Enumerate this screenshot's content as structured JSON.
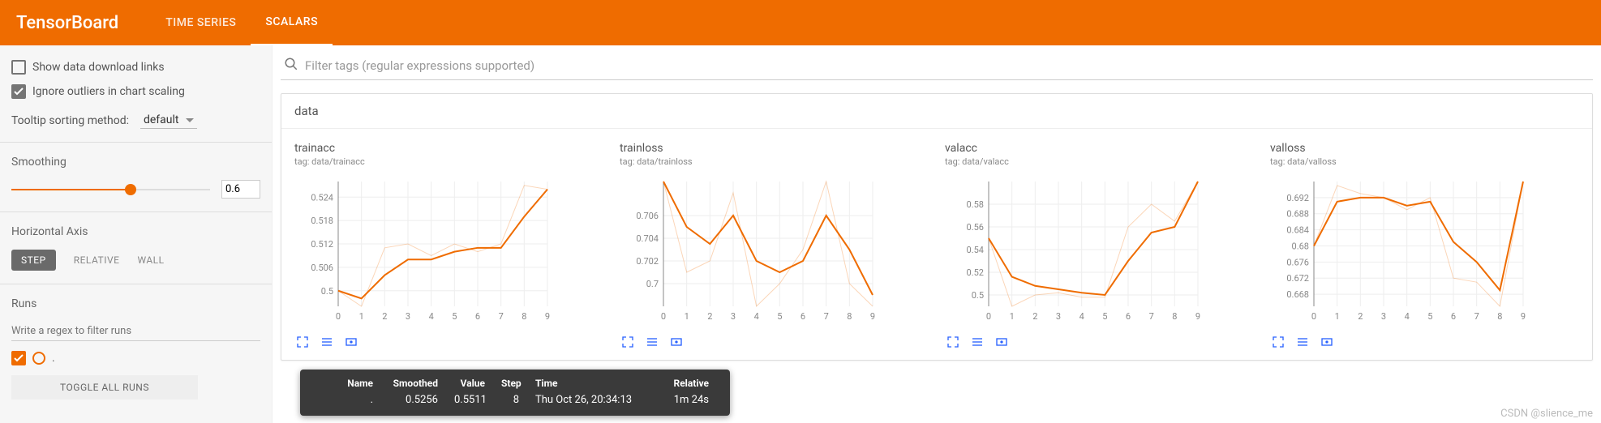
{
  "header": {
    "brand": "TensorBoard",
    "tabs": [
      {
        "label": "TIME SERIES",
        "active": false
      },
      {
        "label": "SCALARS",
        "active": true
      }
    ]
  },
  "sidebar": {
    "show_download": {
      "label": "Show data download links",
      "checked": false
    },
    "ignore_outliers": {
      "label": "Ignore outliers in chart scaling",
      "checked": true
    },
    "tooltip_sort": {
      "label": "Tooltip sorting method:",
      "value": "default"
    },
    "smoothing": {
      "label": "Smoothing",
      "value": "0.6",
      "pct": 60
    },
    "haxis": {
      "label": "Horizontal Axis",
      "options": [
        "STEP",
        "RELATIVE",
        "WALL"
      ],
      "active": 0
    },
    "runs": {
      "label": "Runs",
      "filter_placeholder": "Write a regex to filter runs",
      "items": [
        {
          "label": ".",
          "checked": true
        }
      ],
      "toggle_label": "TOGGLE ALL RUNS"
    }
  },
  "main": {
    "search_placeholder": "Filter tags (regular expressions supported)",
    "group": "data"
  },
  "chart_data": [
    {
      "title": "trainacc",
      "tag": "tag: data/trainacc",
      "type": "line",
      "x": [
        0,
        1,
        2,
        3,
        4,
        5,
        6,
        7,
        8,
        9
      ],
      "yticks": [
        0.5,
        0.506,
        0.512,
        0.518,
        0.524
      ],
      "ylim": [
        0.496,
        0.528
      ],
      "series": [
        {
          "name": "smoothed",
          "values": [
            0.5,
            0.498,
            0.504,
            0.508,
            0.508,
            0.51,
            0.511,
            0.511,
            0.519,
            0.526
          ]
        },
        {
          "name": "raw",
          "values": [
            0.5,
            0.496,
            0.511,
            0.512,
            0.509,
            0.512,
            0.51,
            0.512,
            0.527,
            0.526
          ]
        }
      ]
    },
    {
      "title": "trainloss",
      "tag": "tag: data/trainloss",
      "type": "line",
      "x": [
        0,
        1,
        2,
        3,
        4,
        5,
        6,
        7,
        8,
        9
      ],
      "yticks": [
        0.7,
        0.702,
        0.704,
        0.706
      ],
      "ylim": [
        0.698,
        0.709
      ],
      "series": [
        {
          "name": "smoothed",
          "values": [
            0.709,
            0.705,
            0.7035,
            0.706,
            0.702,
            0.701,
            0.702,
            0.706,
            0.703,
            0.699
          ]
        },
        {
          "name": "raw",
          "values": [
            0.709,
            0.701,
            0.702,
            0.708,
            0.698,
            0.7,
            0.703,
            0.709,
            0.7,
            0.698
          ]
        }
      ]
    },
    {
      "title": "valacc",
      "tag": "tag: data/valacc",
      "type": "line",
      "x": [
        0,
        1,
        2,
        3,
        4,
        5,
        6,
        7,
        8,
        9
      ],
      "yticks": [
        0.5,
        0.52,
        0.54,
        0.56,
        0.58
      ],
      "ylim": [
        0.49,
        0.6
      ],
      "series": [
        {
          "name": "smoothed",
          "values": [
            0.55,
            0.516,
            0.508,
            0.505,
            0.502,
            0.5,
            0.53,
            0.555,
            0.56,
            0.6
          ]
        },
        {
          "name": "raw",
          "values": [
            0.55,
            0.49,
            0.5,
            0.502,
            0.498,
            0.498,
            0.56,
            0.58,
            0.565,
            0.6
          ]
        }
      ]
    },
    {
      "title": "valloss",
      "tag": "tag: data/valloss",
      "type": "line",
      "x": [
        0,
        1,
        2,
        3,
        4,
        5,
        6,
        7,
        8,
        9
      ],
      "yticks": [
        0.668,
        0.672,
        0.676,
        0.68,
        0.684,
        0.688,
        0.692
      ],
      "ylim": [
        0.665,
        0.696
      ],
      "series": [
        {
          "name": "smoothed",
          "values": [
            0.68,
            0.691,
            0.692,
            0.692,
            0.69,
            0.691,
            0.681,
            0.676,
            0.669,
            0.696
          ]
        },
        {
          "name": "raw",
          "values": [
            0.68,
            0.695,
            0.693,
            0.692,
            0.689,
            0.692,
            0.672,
            0.671,
            0.665,
            0.696
          ]
        }
      ]
    }
  ],
  "tooltip": {
    "headers": [
      "Name",
      "Smoothed",
      "Value",
      "Step",
      "Time",
      "Relative"
    ],
    "row": {
      "dot": "#ef6c00",
      "name": ".",
      "smoothed": "0.5256",
      "value": "0.5511",
      "step": "8",
      "time": "Thu Oct 26, 20:34:13",
      "relative": "1m 24s"
    }
  },
  "watermark": "CSDN @slience_me",
  "icons": {
    "search": "search-icon",
    "expand": "expand-icon",
    "list": "list-icon",
    "rect": "rect-icon"
  }
}
